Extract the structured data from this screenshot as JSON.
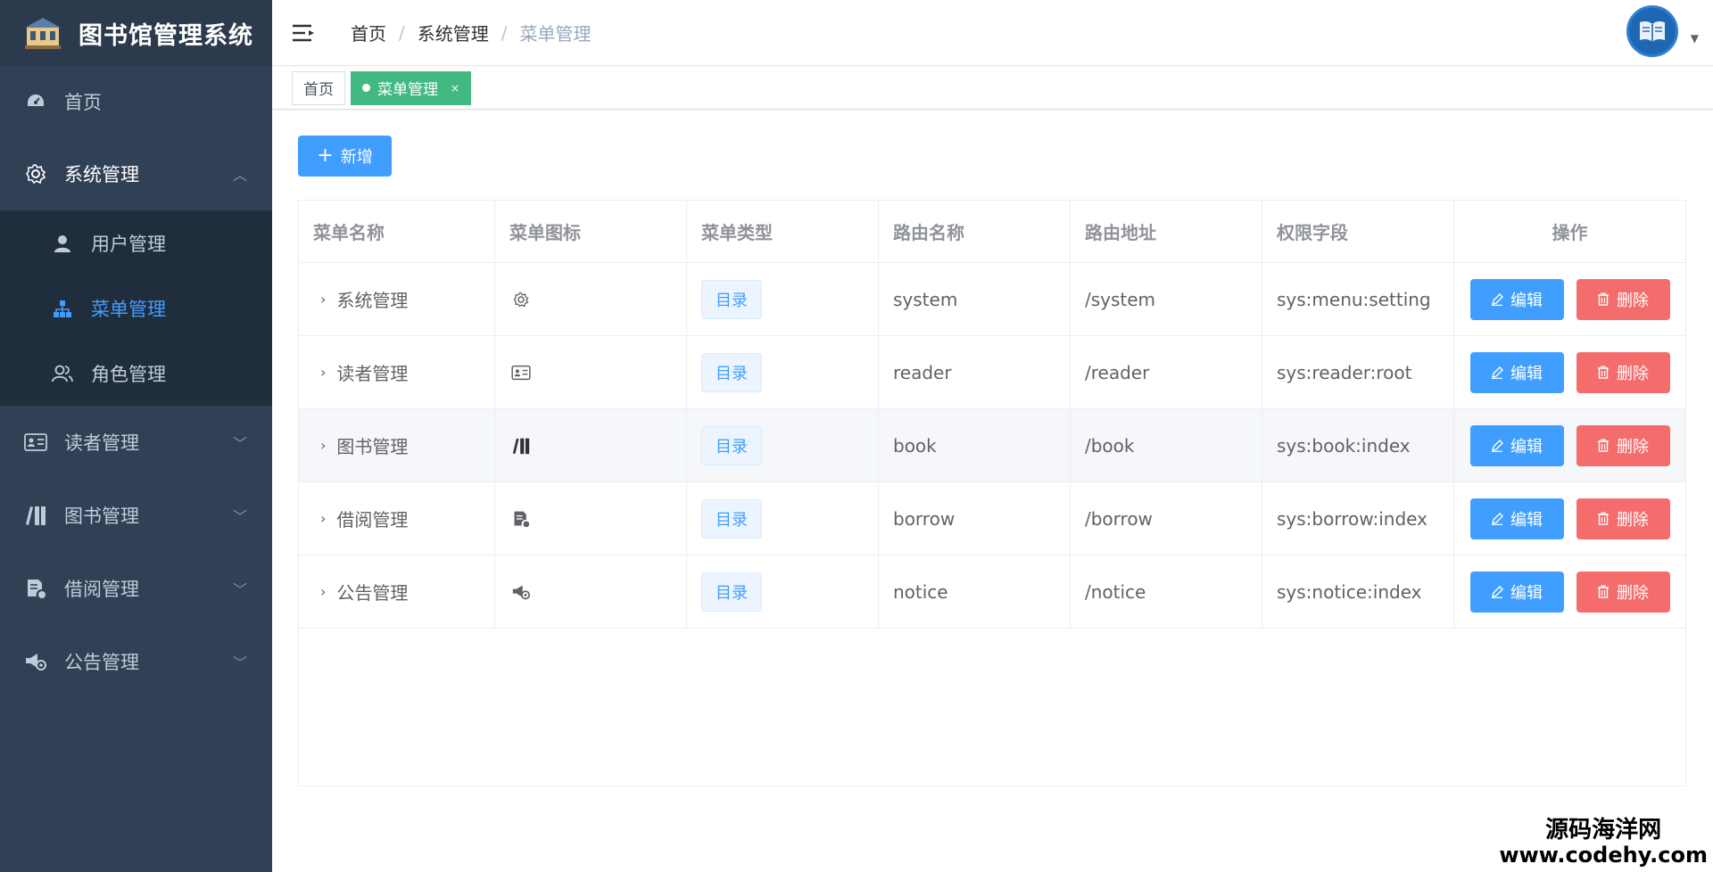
{
  "app": {
    "title": "图书馆管理系统"
  },
  "sidebar": {
    "items": [
      {
        "label": "首页",
        "icon": "dashboard-icon"
      },
      {
        "label": "系统管理",
        "icon": "gear-icon",
        "expanded": true,
        "children": [
          {
            "label": "用户管理",
            "icon": "user-icon"
          },
          {
            "label": "菜单管理",
            "icon": "tree-icon",
            "active": true
          },
          {
            "label": "角色管理",
            "icon": "users-icon"
          }
        ]
      },
      {
        "label": "读者管理",
        "icon": "id-card-icon"
      },
      {
        "label": "图书管理",
        "icon": "books-icon"
      },
      {
        "label": "借阅管理",
        "icon": "borrow-icon"
      },
      {
        "label": "公告管理",
        "icon": "megaphone-icon"
      }
    ]
  },
  "breadcrumb": [
    "首页",
    "系统管理",
    "菜单管理"
  ],
  "tags": [
    {
      "label": "首页",
      "active": false
    },
    {
      "label": "菜单管理",
      "active": true,
      "close": "×"
    }
  ],
  "toolbar": {
    "add_label": "新增",
    "add_icon": "+"
  },
  "table": {
    "columns": [
      "菜单名称",
      "菜单图标",
      "菜单类型",
      "路由名称",
      "路由地址",
      "权限字段",
      "操作"
    ],
    "rows": [
      {
        "name": "系统管理",
        "icon": "gear-icon",
        "type": "目录",
        "route_name": "system",
        "route_path": "/system",
        "perm": "sys:menu:setting"
      },
      {
        "name": "读者管理",
        "icon": "id-card-icon",
        "type": "目录",
        "route_name": "reader",
        "route_path": "/reader",
        "perm": "sys:reader:root"
      },
      {
        "name": "图书管理",
        "icon": "books-icon",
        "type": "目录",
        "route_name": "book",
        "route_path": "/book",
        "perm": "sys:book:index"
      },
      {
        "name": "借阅管理",
        "icon": "borrow-icon",
        "type": "目录",
        "route_name": "borrow",
        "route_path": "/borrow",
        "perm": "sys:borrow:index"
      },
      {
        "name": "公告管理",
        "icon": "megaphone-icon",
        "type": "目录",
        "route_name": "notice",
        "route_path": "/notice",
        "perm": "sys:notice:index"
      }
    ],
    "actions": {
      "edit": "编辑",
      "delete": "删除"
    }
  },
  "watermark": {
    "cn": "源码海洋网",
    "en": "www.codehy.com"
  },
  "colors": {
    "sidebar": "#304156",
    "primary": "#409eff",
    "danger": "#f56c6c",
    "success": "#42b983"
  }
}
